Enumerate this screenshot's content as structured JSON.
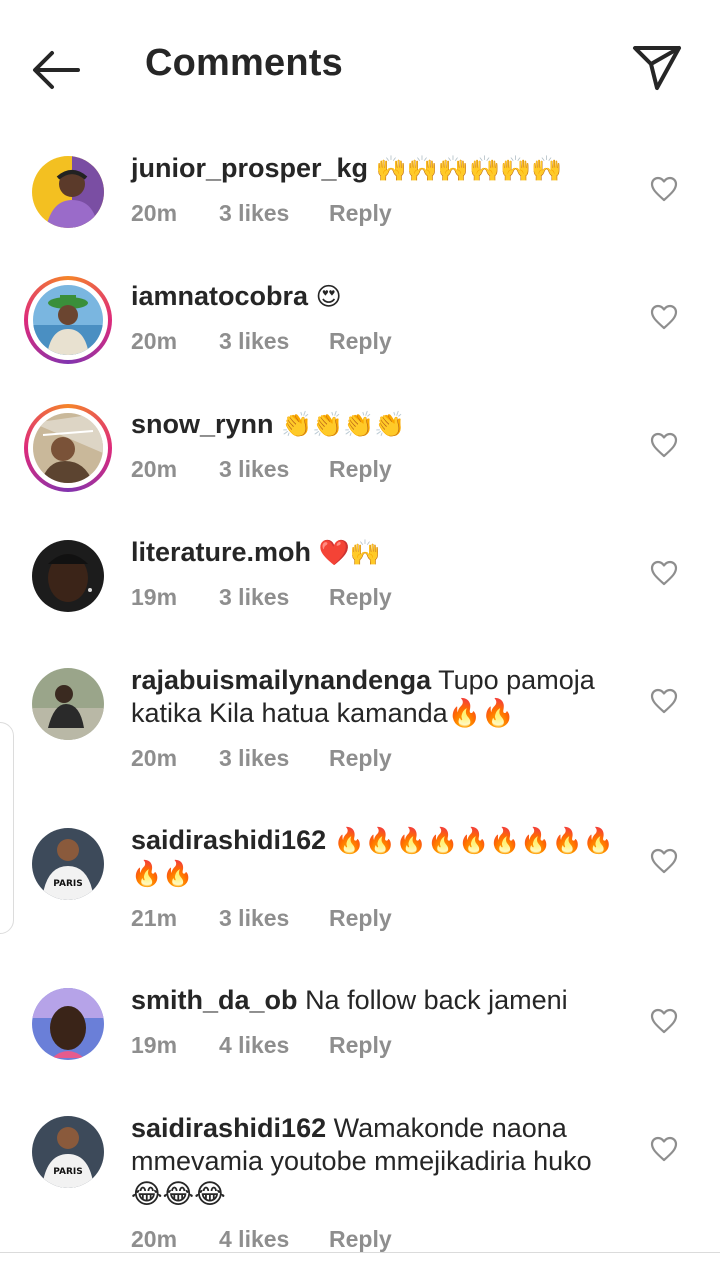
{
  "header": {
    "title": "Comments",
    "back_icon": "arrow-left-icon",
    "share_icon": "paper-plane-icon"
  },
  "colors": {
    "text": "#262626",
    "meta": "#8e8e8e",
    "story_ring": [
      "#f58529",
      "#dd2a7b",
      "#8134af"
    ]
  },
  "comments": [
    {
      "username": "junior_prosper_kg",
      "text": "🙌🙌🙌🙌🙌🙌",
      "time": "20m",
      "likes": "3 likes",
      "reply": "Reply"
    },
    {
      "username": "iamnatocobra",
      "text": "😍",
      "time": "20m",
      "likes": "3 likes",
      "reply": "Reply"
    },
    {
      "username": "snow_rynn",
      "text": "👏👏👏👏",
      "time": "20m",
      "likes": "3 likes",
      "reply": "Reply"
    },
    {
      "username": "literature.moh",
      "text": "❤️🙌",
      "time": "19m",
      "likes": "3 likes",
      "reply": "Reply"
    },
    {
      "username": "rajabuismailynandenga",
      "text": "Tupo pamoja katika Kila hatua kamanda🔥🔥",
      "time": "20m",
      "likes": "3 likes",
      "reply": "Reply"
    },
    {
      "username": "saidirashidi162",
      "text": "🔥🔥🔥🔥🔥🔥🔥🔥🔥🔥🔥",
      "time": "21m",
      "likes": "3 likes",
      "reply": "Reply"
    },
    {
      "username": "smith_da_ob",
      "text": "Na follow back jameni",
      "time": "19m",
      "likes": "4 likes",
      "reply": "Reply"
    },
    {
      "username": "saidirashidi162",
      "text": "Wamakonde naona mmevamia youtobe mmejikadiria huko 😂😂😂",
      "time": "20m",
      "likes": "4 likes",
      "reply": "Reply"
    }
  ]
}
